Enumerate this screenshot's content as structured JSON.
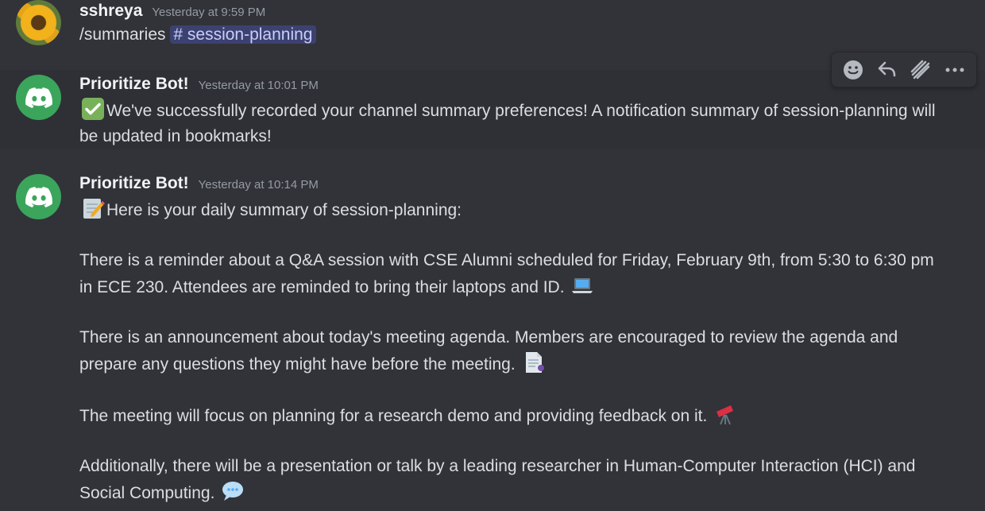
{
  "messages": [
    {
      "author": "sshreya",
      "timestamp": "Yesterday at 9:59 PM",
      "command": "/summaries",
      "channel_mention": "# session-planning"
    },
    {
      "author": "Prioritize Bot!",
      "timestamp": "Yesterday at 10:01 PM",
      "text": "We've successfully recorded your channel summary preferences! A notification summary of session-planning will be updated in bookmarks!"
    },
    {
      "author": "Prioritize Bot!",
      "timestamp": "Yesterday at 10:14 PM",
      "intro": "Here is your daily summary of session-planning:",
      "paragraphs": [
        "There is a reminder about a Q&A session with CSE Alumni scheduled for Friday, February 9th, from 5:30 to 6:30 pm in ECE 230. Attendees are reminded to bring their laptops and ID.",
        "There is an announcement about today's meeting agenda. Members are encouraged to review the agenda and prepare any questions they might have before the meeting.",
        "The meeting will focus on planning for a research demo and providing feedback on it.",
        "Additionally, there will be a presentation or talk by a leading researcher in Human-Computer Interaction (HCI) and Social Computing."
      ]
    }
  ],
  "toolbar_icons": [
    "add-reaction-icon",
    "reply-icon",
    "create-thread-icon",
    "more-options-icon"
  ],
  "colors": {
    "background": "#313338",
    "hover_background": "#2e3035",
    "mention_bg": "#3c4270",
    "bot_avatar": "#3ba55c"
  }
}
